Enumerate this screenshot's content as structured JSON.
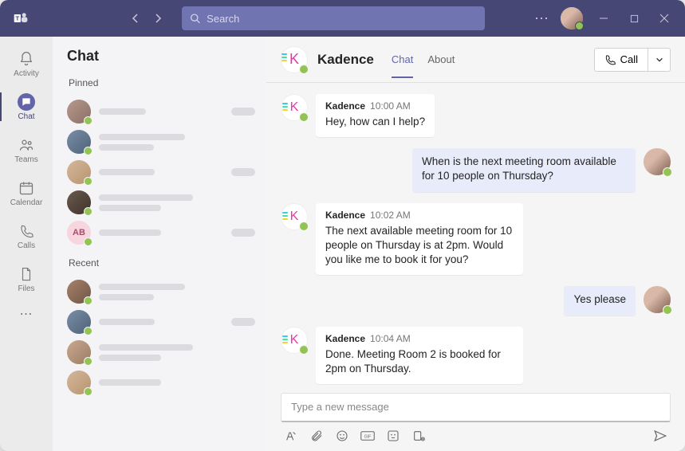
{
  "titlebar": {
    "search_placeholder": "Search"
  },
  "rail": {
    "activity": "Activity",
    "chat": "Chat",
    "teams": "Teams",
    "calendar": "Calendar",
    "calls": "Calls",
    "files": "Files"
  },
  "chatlist": {
    "title": "Chat",
    "pinned_label": "Pinned",
    "recent_label": "Recent",
    "initials_avatar": "AB"
  },
  "header": {
    "bot_name": "Kadence",
    "tab_chat": "Chat",
    "tab_about": "About",
    "call_label": "Call"
  },
  "messages": [
    {
      "from": "bot",
      "name": "Kadence",
      "time": "10:00 AM",
      "text": "Hey, how can I help?"
    },
    {
      "from": "user",
      "text": "When is the next meeting room available for 10 people on Thursday?"
    },
    {
      "from": "bot",
      "name": "Kadence",
      "time": "10:02 AM",
      "text": "The next available meeting room for 10 people on Thursday is at 2pm. Would you like me to book it for you?"
    },
    {
      "from": "user",
      "text": "Yes please"
    },
    {
      "from": "bot",
      "name": "Kadence",
      "time": "10:04 AM",
      "text": " Done. Meeting Room 2 is booked for 2pm on Thursday."
    }
  ],
  "composer": {
    "placeholder": "Type a new message"
  }
}
